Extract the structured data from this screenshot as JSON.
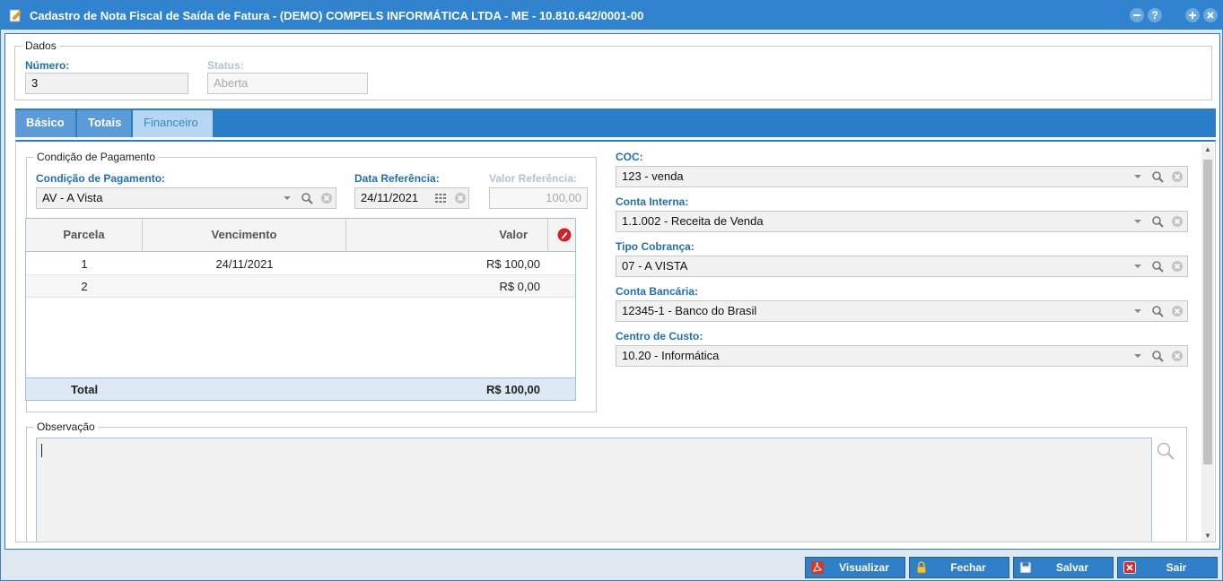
{
  "window": {
    "title": "Cadastro de Nota Fiscal de Saída de Fatura - (DEMO) COMPELS INFORMÁTICA LTDA - ME - 10.810.642/0001-00",
    "help_label": "?"
  },
  "dados": {
    "legend": "Dados",
    "numero_label": "Número:",
    "numero_value": "3",
    "status_label": "Status:",
    "status_value": "Aberta"
  },
  "tabs": [
    {
      "label": "Básico"
    },
    {
      "label": "Totais"
    },
    {
      "label": "Financeiro"
    }
  ],
  "pagamento": {
    "legend": "Condição de Pagamento",
    "condicao_label": "Condição de Pagamento:",
    "condicao_value": "AV - A Vista",
    "data_ref_label": "Data Referência:",
    "data_ref_value": "24/11/2021",
    "valor_ref_label": "Valor Referência:",
    "valor_ref_value": "100,00"
  },
  "parcelas": {
    "columns": [
      "Parcela",
      "Vencimento",
      "Valor"
    ],
    "rows": [
      {
        "parcela": "1",
        "vencimento": "24/11/2021",
        "valor": "R$ 100,00"
      },
      {
        "parcela": "2",
        "vencimento": "",
        "valor": "R$ 0,00"
      }
    ],
    "total_label": "Total",
    "total_value": "R$ 100,00"
  },
  "right_fields": {
    "coc_label": "COC:",
    "coc_value": "123 - venda",
    "conta_interna_label": "Conta Interna:",
    "conta_interna_value": "1.1.002 - Receita de Venda",
    "tipo_cobranca_label": "Tipo Cobrança:",
    "tipo_cobranca_value": "07 - A VISTA",
    "conta_bancaria_label": "Conta Bancária:",
    "conta_bancaria_value": "12345-1 - Banco do Brasil",
    "centro_custo_label": "Centro de Custo:",
    "centro_custo_value": "10.20 - Informática"
  },
  "observacao": {
    "legend": "Observação",
    "value": ""
  },
  "footer": {
    "visualizar": "Visualizar",
    "fechar": "Fechar",
    "salvar": "Salvar",
    "sair": "Sair"
  },
  "colors": {
    "titlebar": "#2f83cf",
    "label_blue": "#1f6fb8",
    "button_blue": "#2f7fc9",
    "delete_red": "#d0202a"
  },
  "icons": [
    "edit-document-icon",
    "minimize-icon",
    "help-icon",
    "maximize-icon",
    "close-icon",
    "dropdown-arrow-icon",
    "search-icon",
    "clear-icon",
    "calendar-icon",
    "delete-row-icon",
    "pdf-icon",
    "lock-icon",
    "save-icon",
    "exit-icon"
  ]
}
